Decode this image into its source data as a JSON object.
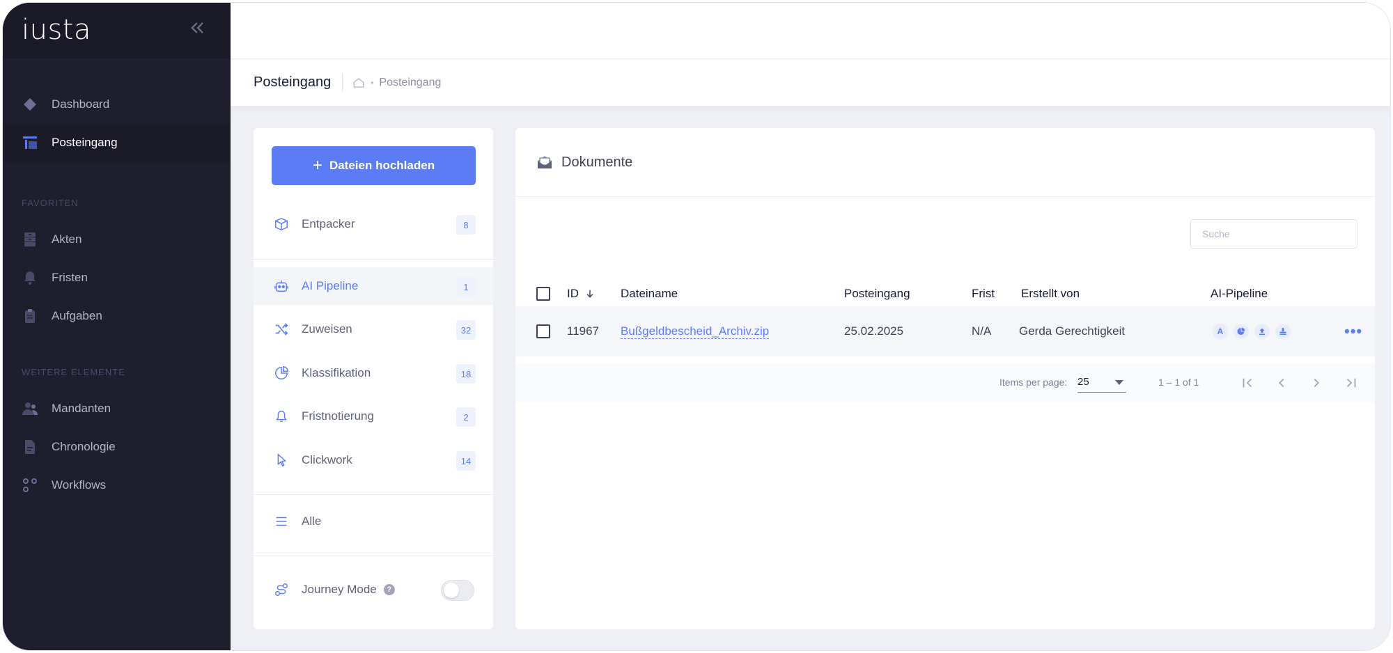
{
  "app": {
    "logo": "iusta"
  },
  "sidebar": {
    "items": [
      {
        "label": "Dashboard",
        "icon": "layers-icon"
      },
      {
        "label": "Posteingang",
        "icon": "inbox-icon",
        "active": true
      }
    ],
    "favorites_label": "FAVORITEN",
    "favorites": [
      {
        "label": "Akten",
        "icon": "archive-icon"
      },
      {
        "label": "Fristen",
        "icon": "bell-icon"
      },
      {
        "label": "Aufgaben",
        "icon": "clipboard-icon"
      }
    ],
    "more_label": "WEITERE ELEMENTE",
    "more": [
      {
        "label": "Mandanten",
        "icon": "users-icon"
      },
      {
        "label": "Chronologie",
        "icon": "file-icon"
      },
      {
        "label": "Workflows",
        "icon": "workflow-icon"
      }
    ]
  },
  "header": {
    "page_title": "Posteingang",
    "breadcrumb": "Posteingang"
  },
  "left_panel": {
    "upload_label": "Dateien hochladen",
    "items": [
      {
        "label": "Entpacker",
        "count": "8"
      },
      {
        "label": "AI Pipeline",
        "count": "1",
        "active": true
      },
      {
        "label": "Zuweisen",
        "count": "32"
      },
      {
        "label": "Klassifikation",
        "count": "18"
      },
      {
        "label": "Fristnotierung",
        "count": "2"
      },
      {
        "label": "Clickwork",
        "count": "14"
      }
    ],
    "all_label": "Alle",
    "journey_label": "Journey Mode",
    "journey_enabled": false
  },
  "documents": {
    "title": "Dokumente",
    "search_placeholder": "Suche",
    "columns": {
      "id": "ID",
      "filename": "Dateiname",
      "received": "Posteingang",
      "deadline": "Frist",
      "created_by": "Erstellt von",
      "pipeline": "AI-Pipeline"
    },
    "rows": [
      {
        "id": "11967",
        "filename": "Bußgeldbescheid_Archiv.zip",
        "received": "25.02.2025",
        "deadline": "N/A",
        "created_by": "Gerda Gerechtigkeit",
        "pipeline_icons": [
          "text-icon",
          "pie-icon",
          "upload-icon",
          "stamp-icon"
        ]
      }
    ],
    "paginator": {
      "items_per_page_label": "Items per page:",
      "page_size": "25",
      "range": "1 – 1 of 1"
    }
  },
  "colors": {
    "accent": "#5b7cf5",
    "sidebar": "#1e1e2d",
    "background": "#eef0f5"
  }
}
